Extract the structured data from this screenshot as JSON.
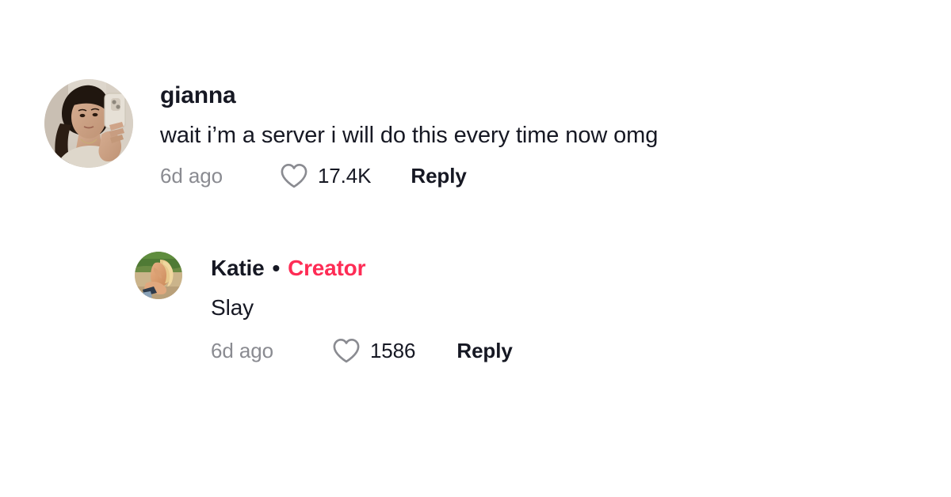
{
  "theme": {
    "background": "#ffffff",
    "text_primary": "#161823",
    "text_muted": "#8a8b91",
    "accent_creator": "#fe2c55"
  },
  "comment": {
    "username": "gianna",
    "avatar_alt": "gianna-profile-photo",
    "text": "wait i’m a server i will do this every time now omg",
    "time": "6d ago",
    "like_count": "17.4K",
    "like_icon": "heart-icon",
    "reply_label": "Reply"
  },
  "reply": {
    "username": "Katie",
    "separator": "•",
    "badge": "Creator",
    "avatar_alt": "katie-profile-photo",
    "text": "Slay",
    "time": "6d ago",
    "like_count": "1586",
    "like_icon": "heart-icon",
    "reply_label": "Reply"
  }
}
